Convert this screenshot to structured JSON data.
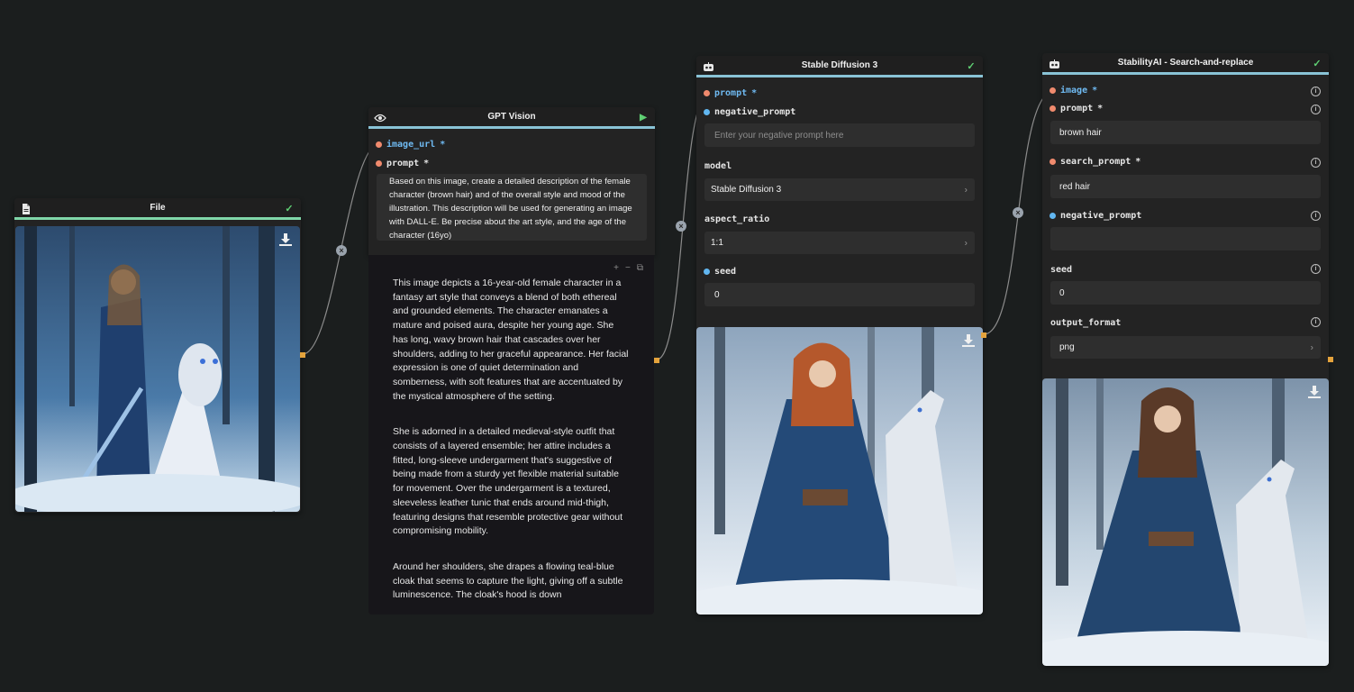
{
  "nodes": {
    "file": {
      "title": "File"
    },
    "gpt": {
      "title": "GPT Vision",
      "inputs": {
        "image_url": "image_url",
        "prompt": "prompt",
        "required": "*"
      },
      "prompt_text": "Based on this image, create a detailed description of the female character (brown hair) and of the overall style and mood of the illustration. This description will be used for generating an image with DALL-E. Be precise about the art style, and the age of the character (16yo)",
      "output_paragraphs": [
        "This image depicts a 16-year-old female character in a fantasy art style that conveys a blend of both ethereal and grounded elements. The character emanates a mature and poised aura, despite her young age. She has long, wavy brown hair that cascades over her shoulders, adding to her graceful appearance. Her facial expression is one of quiet determination and somberness, with soft features that are accentuated by the mystical atmosphere of the setting.",
        "She is adorned in a detailed medieval-style outfit that consists of a layered ensemble; her attire includes a fitted, long-sleeve undergarment that's suggestive of being made from a sturdy yet flexible material suitable for movement. Over the undergarment is a textured, sleeveless leather tunic that ends around mid-thigh, featuring designs that resemble protective gear without compromising mobility.",
        "Around her shoulders, she drapes a flowing teal-blue cloak that seems to capture the light, giving off a subtle luminescence. The cloak's hood is down"
      ],
      "tools": {
        "plus": "+",
        "minus": "−",
        "copy": "⧉"
      }
    },
    "sd3": {
      "title": "Stable Diffusion 3",
      "prompt_label": "prompt",
      "negative_label": "negative_prompt",
      "negative_placeholder": "Enter your negative prompt here",
      "model_label": "model",
      "model_value": "Stable Diffusion 3",
      "aspect_label": "aspect_ratio",
      "aspect_value": "1:1",
      "seed_label": "seed",
      "seed_value": "0",
      "required": "*"
    },
    "sar": {
      "title": "StabilityAI - Search-and-replace",
      "image_label": "image",
      "prompt_label": "prompt",
      "prompt_value": "brown hair",
      "search_label": "search_prompt",
      "search_value": "red hair",
      "negative_label": "negative_prompt",
      "negative_value": "",
      "seed_label": "seed",
      "seed_value": "0",
      "format_label": "output_format",
      "format_value": "png",
      "required": "*"
    }
  },
  "icons": {
    "file": "document-icon",
    "gpt": "eye-icon",
    "sd3": "robot-icon",
    "sar": "robot-icon",
    "status_check": "check-icon",
    "run": "play-icon",
    "download": "download-icon",
    "info": "info-icon",
    "chevron": "chevron-right-icon",
    "wire_joint": "close-icon"
  },
  "colors": {
    "canvas": "#1b1e1e",
    "node": "#232323",
    "header_accent_green": "#7fd6a8",
    "header_accent_blue": "#89c3d6",
    "port_required": "#f08a6d",
    "port_optional": "#61b6f0",
    "output_port": "#e4a33c",
    "status_ok": "#5fcf73"
  },
  "glyphs": {
    "check": "✓",
    "play": "▶",
    "chevron": "›",
    "info": "i",
    "close": "×"
  }
}
